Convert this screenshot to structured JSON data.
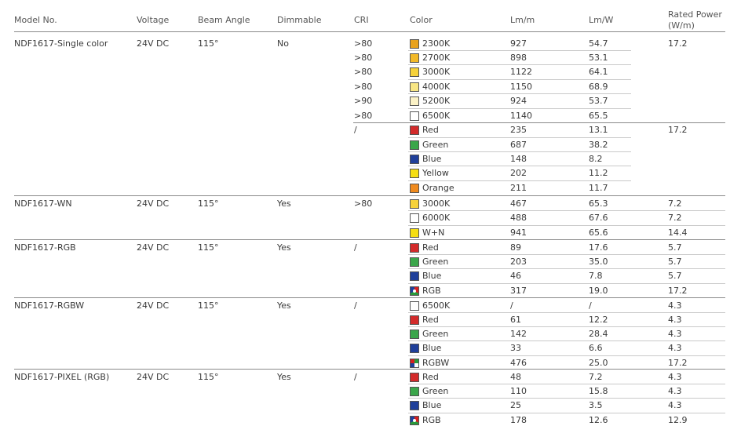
{
  "headers": {
    "model": "Model No.",
    "voltage": "Voltage",
    "beam": "Beam Angle",
    "dimmable": "Dimmable",
    "cri": "CRI",
    "color": "Color",
    "lmm": "Lm/m",
    "lmw": "Lm/W",
    "power_1": "Rated Power",
    "power_2": "(W/m)"
  },
  "swatch_colors": {
    "2300K": "#e8a21c",
    "2700K": "#f2b928",
    "3000K": "#f6d23a",
    "4000K": "#f8e684",
    "5200K": "#fbf2c6",
    "6500K": "#ffffff",
    "6000K": "#ffffff",
    "Red": "#d32a2a",
    "Green": "#3aa64a",
    "Blue": "#1f3f9a",
    "Yellow": "#f5de12",
    "Orange": "#ef8a1e",
    "W+N": "#f5de12"
  },
  "groups": [
    {
      "model": "NDF1617-Single color",
      "voltage": "24V DC",
      "beam": "115°",
      "dimmable": "No",
      "rows": [
        {
          "cri": ">80",
          "color": "2300K",
          "swatch": "2300K",
          "lmm": "927",
          "lmw": "54.7",
          "power": "17.2"
        },
        {
          "cri": ">80",
          "color": "2700K",
          "swatch": "2700K",
          "lmm": "898",
          "lmw": "53.1",
          "power": ""
        },
        {
          "cri": ">80",
          "color": "3000K",
          "swatch": "3000K",
          "lmm": "1122",
          "lmw": "64.1",
          "power": ""
        },
        {
          "cri": ">80",
          "color": "4000K",
          "swatch": "4000K",
          "lmm": "1150",
          "lmw": "68.9",
          "power": ""
        },
        {
          "cri": ">90",
          "color": "5200K",
          "swatch": "5200K",
          "lmm": "924",
          "lmw": "53.7",
          "power": ""
        },
        {
          "cri": ">80",
          "color": "6500K",
          "swatch": "6500K",
          "lmm": "1140",
          "lmw": "65.5",
          "power": ""
        },
        {
          "cri": "/",
          "color": "Red",
          "swatch": "Red",
          "lmm": "235",
          "lmw": "13.1",
          "power": "17.2"
        },
        {
          "cri": "",
          "color": "Green",
          "swatch": "Green",
          "lmm": "687",
          "lmw": "38.2",
          "power": ""
        },
        {
          "cri": "",
          "color": "Blue",
          "swatch": "Blue",
          "lmm": "148",
          "lmw": "8.2",
          "power": ""
        },
        {
          "cri": "",
          "color": "Yellow",
          "swatch": "Yellow",
          "lmm": "202",
          "lmw": "11.2",
          "power": ""
        },
        {
          "cri": "",
          "color": "Orange",
          "swatch": "Orange",
          "lmm": "211",
          "lmw": "11.7",
          "power": ""
        }
      ]
    },
    {
      "model": "NDF1617-WN",
      "voltage": "24V DC",
      "beam": "115°",
      "dimmable": "Yes",
      "rows": [
        {
          "cri": ">80",
          "color": "3000K",
          "swatch": "3000K",
          "lmm": "467",
          "lmw": "65.3",
          "power": "7.2"
        },
        {
          "cri": "",
          "color": "6000K",
          "swatch": "6000K",
          "lmm": "488",
          "lmw": "67.6",
          "power": "7.2"
        },
        {
          "cri": "",
          "color": "W+N",
          "swatch": "W+N",
          "lmm": "941",
          "lmw": "65.6",
          "power": "14.4"
        }
      ]
    },
    {
      "model": "NDF1617-RGB",
      "voltage": "24V DC",
      "beam": "115°",
      "dimmable": "Yes",
      "rows": [
        {
          "cri": "/",
          "color": "Red",
          "swatch": "Red",
          "lmm": "89",
          "lmw": "17.6",
          "power": "5.7"
        },
        {
          "cri": "",
          "color": "Green",
          "swatch": "Green",
          "lmm": "203",
          "lmw": "35.0",
          "power": "5.7"
        },
        {
          "cri": "",
          "color": "Blue",
          "swatch": "Blue",
          "lmm": "46",
          "lmw": "7.8",
          "power": "5.7"
        },
        {
          "cri": "",
          "color": "RGB",
          "swatch": "rgb",
          "lmm": "317",
          "lmw": "19.0",
          "power": "17.2"
        }
      ]
    },
    {
      "model": "NDF1617-RGBW",
      "voltage": "24V DC",
      "beam": "115°",
      "dimmable": "Yes",
      "rows": [
        {
          "cri": "/",
          "color": "6500K",
          "swatch": "6500K",
          "lmm": "/",
          "lmw": "/",
          "power": "4.3"
        },
        {
          "cri": "",
          "color": "Red",
          "swatch": "Red",
          "lmm": "61",
          "lmw": "12.2",
          "power": "4.3"
        },
        {
          "cri": "",
          "color": "Green",
          "swatch": "Green",
          "lmm": "142",
          "lmw": "28.4",
          "power": "4.3"
        },
        {
          "cri": "",
          "color": "Blue",
          "swatch": "Blue",
          "lmm": "33",
          "lmw": "6.6",
          "power": "4.3"
        },
        {
          "cri": "",
          "color": "RGBW",
          "swatch": "rgbw",
          "lmm": "476",
          "lmw": "25.0",
          "power": "17.2"
        }
      ]
    },
    {
      "model": "NDF1617-PIXEL (RGB)",
      "voltage": "24V DC",
      "beam": "115°",
      "dimmable": "Yes",
      "rows": [
        {
          "cri": "/",
          "color": "Red",
          "swatch": "Red",
          "lmm": "48",
          "lmw": "7.2",
          "power": "4.3"
        },
        {
          "cri": "",
          "color": "Green",
          "swatch": "Green",
          "lmm": "110",
          "lmw": "15.8",
          "power": "4.3"
        },
        {
          "cri": "",
          "color": "Blue",
          "swatch": "Blue",
          "lmm": "25",
          "lmw": "3.5",
          "power": "4.3"
        },
        {
          "cri": "",
          "color": "RGB",
          "swatch": "rgb",
          "lmm": "178",
          "lmw": "12.6",
          "power": "12.9"
        }
      ]
    }
  ]
}
